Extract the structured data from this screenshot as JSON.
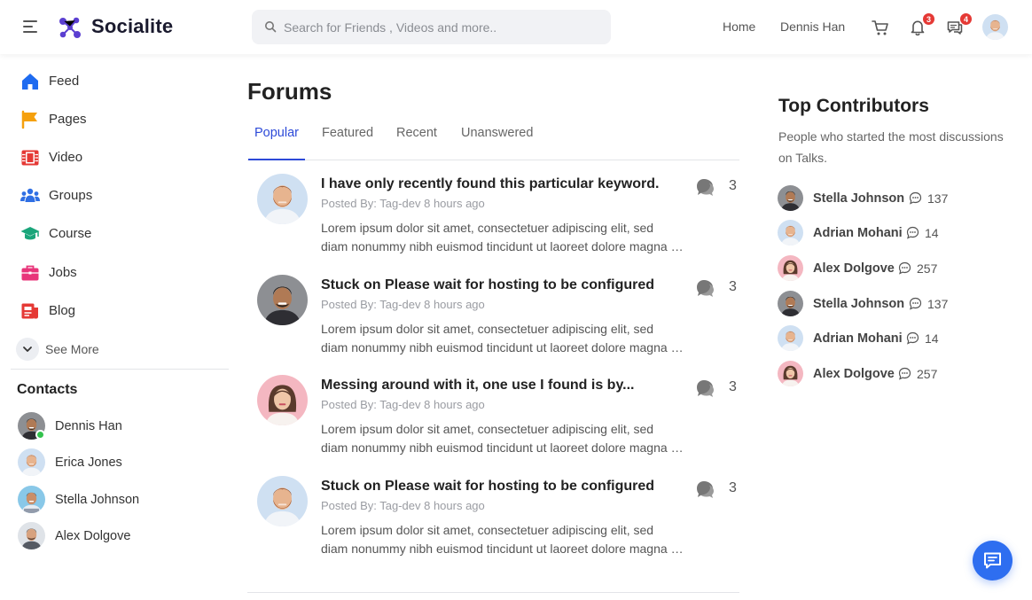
{
  "header": {
    "brand": "Socialite",
    "search_placeholder": "Search for Friends , Videos and more..",
    "nav": {
      "home": "Home",
      "user_name": "Dennis Han"
    },
    "notifications_count": "3",
    "messages_count": "4",
    "icons": {
      "menu": "hamburger-icon",
      "cart": "cart-icon",
      "bell": "bell-icon",
      "messages": "chat-bubbles-icon",
      "search": "search-icon"
    },
    "colors": {
      "badge": "#e53935",
      "brand": "#5b3fd1"
    }
  },
  "sidebar": {
    "items": [
      {
        "label": "Feed",
        "icon": "home-icon",
        "color": "#1e6bf0"
      },
      {
        "label": "Pages",
        "icon": "flag-icon",
        "color": "#f5a00d"
      },
      {
        "label": "Video",
        "icon": "film-icon",
        "color": "#e53935"
      },
      {
        "label": "Groups",
        "icon": "groups-icon",
        "color": "#2f6fe4"
      },
      {
        "label": "Course",
        "icon": "graduation-cap-icon",
        "color": "#1aa57a"
      },
      {
        "label": "Jobs",
        "icon": "briefcase-icon",
        "color": "#e8357a"
      },
      {
        "label": "Blog",
        "icon": "blog-icon",
        "color": "#e53935"
      }
    ],
    "see_more": "See More",
    "contacts_title": "Contacts",
    "contacts": [
      {
        "name": "Dennis Han",
        "online": true
      },
      {
        "name": "Erica Jones",
        "online": false
      },
      {
        "name": "Stella Johnson",
        "online": false
      },
      {
        "name": "Alex Dolgove",
        "online": false
      }
    ]
  },
  "main": {
    "title": "Forums",
    "tabs": [
      "Popular",
      "Featured",
      "Recent",
      "Unanswered"
    ],
    "active_tab": "Popular",
    "posts": [
      {
        "title": "I have only recently found this particular keyword.",
        "meta": "Posted By: Tag-dev 8 hours ago",
        "line1": "Lorem ipsum dolor sit amet, consectetuer adipiscing elit, sed",
        "line2": "diam nonummy nibh euismod tincidunt ut laoreet dolore magna aliquam erat volutpat.",
        "comments": "3"
      },
      {
        "title": "Stuck on Please wait for hosting to be configured",
        "meta": "Posted By: Tag-dev 8 hours ago",
        "line1": "Lorem ipsum dolor sit amet, consectetuer adipiscing elit, sed",
        "line2": "diam nonummy nibh euismod tincidunt ut laoreet dolore magna aliquam erat volutpat.",
        "comments": "3"
      },
      {
        "title": "Messing around with it, one use I found is by...",
        "meta": "Posted By: Tag-dev 8 hours ago",
        "line1": "Lorem ipsum dolor sit amet, consectetuer adipiscing elit, sed",
        "line2": "diam nonummy nibh euismod tincidunt ut laoreet dolore magna aliquam erat volutpat.",
        "comments": "3"
      },
      {
        "title": "Stuck on Please wait for hosting to be configured",
        "meta": "Posted By: Tag-dev 8 hours ago",
        "line1": "Lorem ipsum dolor sit amet, consectetuer adipiscing elit, sed",
        "line2": "diam nonummy nibh euismod tincidunt ut laoreet dolore magna aliquam erat volutpat.",
        "comments": "3"
      }
    ]
  },
  "right": {
    "title": "Top Contributors",
    "subtitle": "People who started the most discussions on Talks.",
    "contributors": [
      {
        "name": "Stella Johnson",
        "count": "137"
      },
      {
        "name": "Adrian Mohani",
        "count": "14"
      },
      {
        "name": "Alex Dolgove",
        "count": "257"
      },
      {
        "name": "Stella Johnson",
        "count": "137"
      },
      {
        "name": "Adrian Mohani",
        "count": "14"
      },
      {
        "name": "Alex Dolgove",
        "count": "257"
      }
    ]
  },
  "chat_fab_icon": "chat-icon"
}
